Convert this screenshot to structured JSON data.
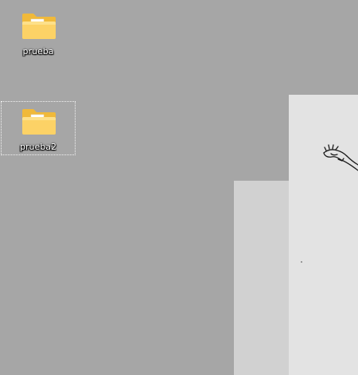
{
  "desktop": {
    "background_color": "#a6a6a6",
    "icons": [
      {
        "label": "prueba",
        "icon": "folder-icon",
        "selected": false
      },
      {
        "label": "prueba2",
        "icon": "folder-icon",
        "selected": true
      }
    ]
  },
  "wallpaper": {
    "panel_left_color": "#d1d1d1",
    "panel_right_color": "#e3e3e3",
    "sketch": "hand-sketch-drawing"
  },
  "colors": {
    "folder_back": "#f0b93a",
    "folder_front": "#fcd266",
    "paper": "#ffffff",
    "label_text": "#ffffff"
  }
}
